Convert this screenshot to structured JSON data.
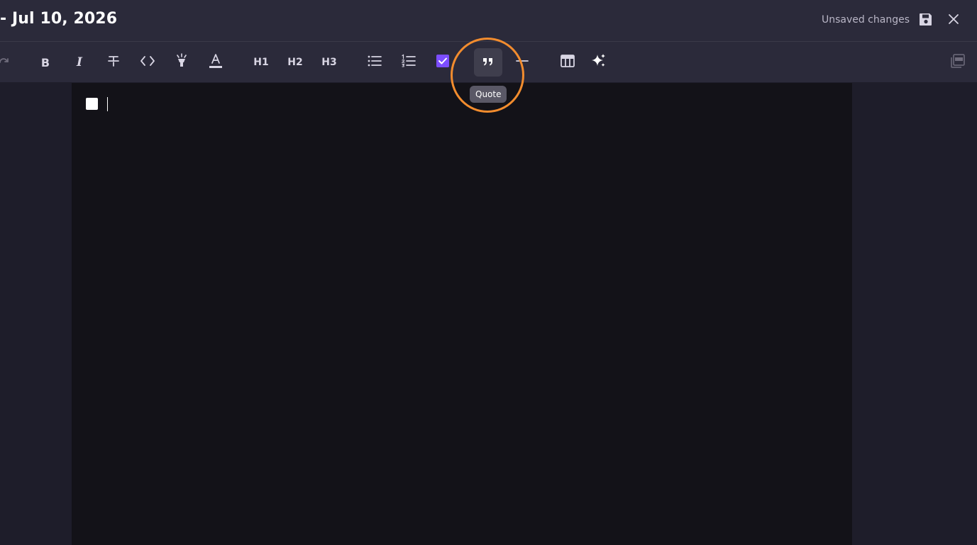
{
  "header": {
    "title": "- Jul 10, 2026",
    "status": "Unsaved changes",
    "save_icon": "floppy-disk-icon",
    "close_icon": "close-icon"
  },
  "toolbar": {
    "buttons": [
      {
        "name": "redo",
        "icon": "redo-icon"
      },
      {
        "name": "bold",
        "label": "B",
        "icon": "bold-icon"
      },
      {
        "name": "italic",
        "label": "I",
        "icon": "italic-icon"
      },
      {
        "name": "strikethrough",
        "icon": "strikethrough-icon"
      },
      {
        "name": "code",
        "icon": "code-icon"
      },
      {
        "name": "highlight",
        "icon": "highlighter-icon"
      },
      {
        "name": "text-color",
        "icon": "text-color-icon"
      },
      {
        "name": "h1",
        "label": "H1"
      },
      {
        "name": "h2",
        "label": "H2"
      },
      {
        "name": "h3",
        "label": "H3"
      },
      {
        "name": "bullet-list",
        "icon": "bullet-list-icon"
      },
      {
        "name": "ordered-list",
        "icon": "ordered-list-icon"
      },
      {
        "name": "task-list",
        "icon": "checkbox-icon"
      },
      {
        "name": "quote",
        "icon": "quote-icon",
        "active": true
      },
      {
        "name": "horizontal-rule",
        "icon": "horizontal-rule-icon"
      },
      {
        "name": "table",
        "icon": "table-icon"
      },
      {
        "name": "ai",
        "icon": "sparkles-icon"
      },
      {
        "name": "export-pdf",
        "icon": "pdf-icon"
      }
    ],
    "tooltip": "Quote",
    "accent_color": "#7c4dff",
    "highlight_color": "#f28c2e"
  },
  "editor": {
    "content": "",
    "task_checked": false
  }
}
